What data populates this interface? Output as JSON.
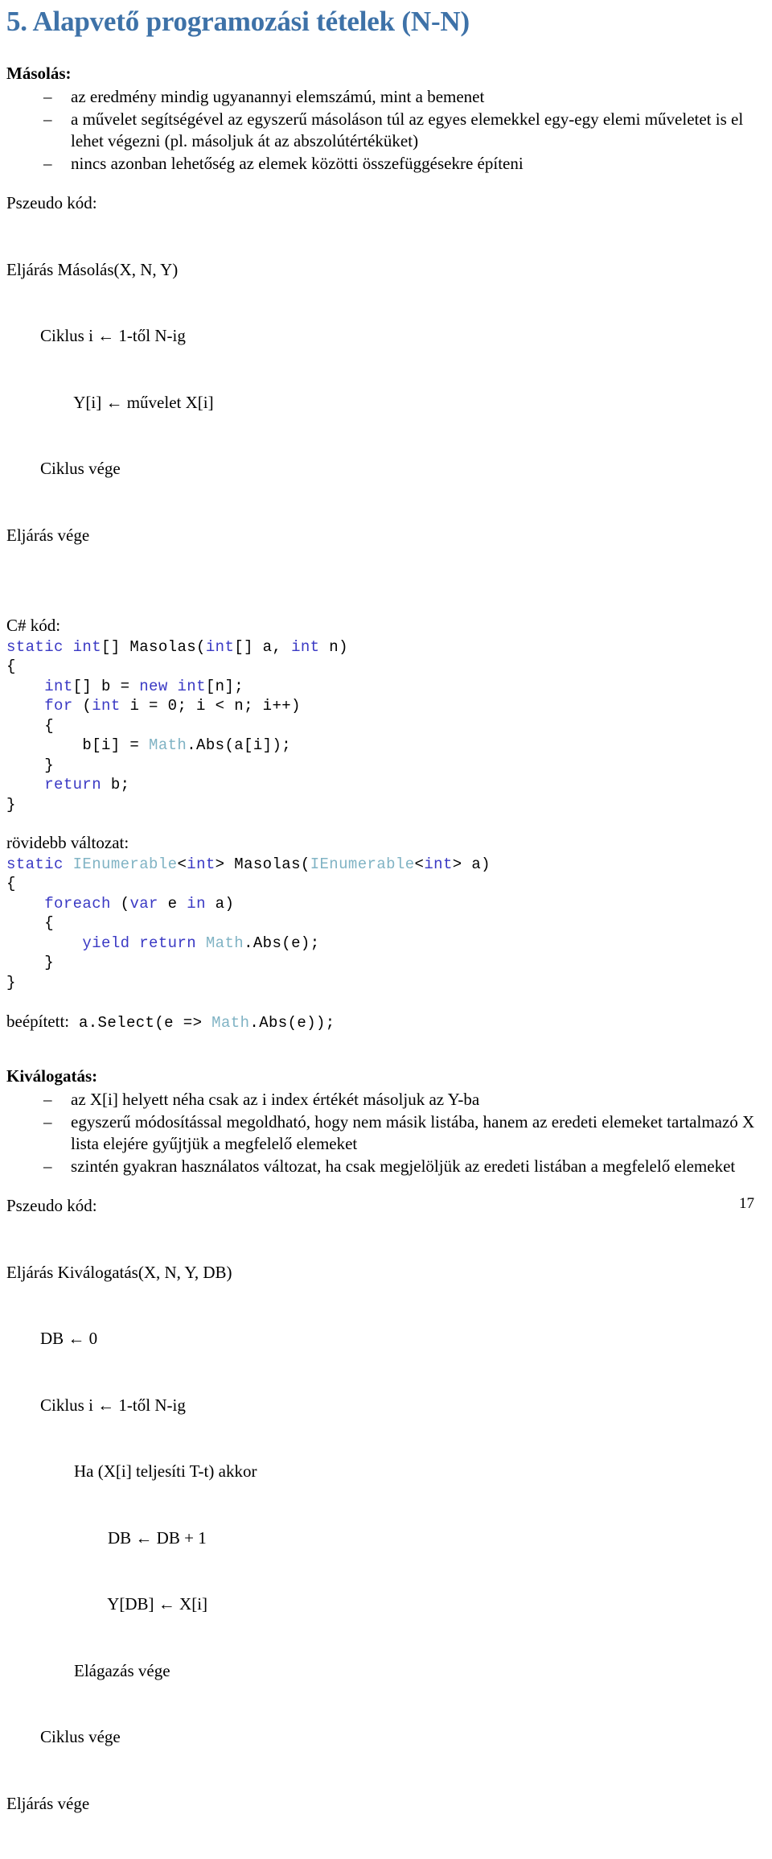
{
  "document": {
    "title": "5. Alapvető programozási tételek (N-N)",
    "title_color": "#3E72A8",
    "page_number": "17"
  },
  "sections": [
    {
      "heading": "Másolás:",
      "bullets": [
        "az eredmény mindig ugyanannyi elemszámú, mint a bemenet",
        "a művelet segítségével az egyszerű másoláson túl az egyes elemekkel egy-egy elemi műveletet is el lehet végezni (pl. másoljuk át az abszolútértéküket)",
        "nincs azonban lehetőség az elemek közötti összefüggésekre építeni"
      ],
      "pseudo_label": "Pszeudo kód:",
      "pseudo_lines": [
        "Eljárás Másolás(X, N, Y)",
        "        Ciklus i ← 1-től N-ig",
        "                Y[i] ← művelet X[i]",
        "        Ciklus vége",
        "Eljárás vége"
      ]
    }
  ],
  "csharp": {
    "label": "C# kód:",
    "lines": [
      [
        {
          "t": "static",
          "c": "kw"
        },
        {
          "t": " ",
          "c": "pun"
        },
        {
          "t": "int",
          "c": "kw"
        },
        {
          "t": "[] Masolas(",
          "c": "pun"
        },
        {
          "t": "int",
          "c": "kw"
        },
        {
          "t": "[] a, ",
          "c": "pun"
        },
        {
          "t": "int",
          "c": "kw"
        },
        {
          "t": " n)",
          "c": "pun"
        }
      ],
      [
        {
          "t": "{",
          "c": "pun"
        }
      ],
      [
        {
          "t": "    ",
          "c": "pun"
        },
        {
          "t": "int",
          "c": "kw"
        },
        {
          "t": "[] b = ",
          "c": "pun"
        },
        {
          "t": "new",
          "c": "kw"
        },
        {
          "t": " ",
          "c": "pun"
        },
        {
          "t": "int",
          "c": "kw"
        },
        {
          "t": "[n];",
          "c": "pun"
        }
      ],
      [
        {
          "t": "    ",
          "c": "pun"
        },
        {
          "t": "for",
          "c": "kw"
        },
        {
          "t": " (",
          "c": "pun"
        },
        {
          "t": "int",
          "c": "kw"
        },
        {
          "t": " i = 0; i < n; i++)",
          "c": "pun"
        }
      ],
      [
        {
          "t": "    {",
          "c": "pun"
        }
      ],
      [
        {
          "t": "        b[i] = ",
          "c": "pun"
        },
        {
          "t": "Math",
          "c": "typ"
        },
        {
          "t": ".Abs(a[i]);",
          "c": "pun"
        }
      ],
      [
        {
          "t": "    }",
          "c": "pun"
        }
      ],
      [
        {
          "t": "    ",
          "c": "pun"
        },
        {
          "t": "return",
          "c": "kw"
        },
        {
          "t": " b;",
          "c": "pun"
        }
      ],
      [
        {
          "t": "}",
          "c": "pun"
        }
      ]
    ]
  },
  "shorter": {
    "label": "rövidebb változat:",
    "lines": [
      [
        {
          "t": "static",
          "c": "kw"
        },
        {
          "t": " ",
          "c": "pun"
        },
        {
          "t": "IEnumerable",
          "c": "typ"
        },
        {
          "t": "<",
          "c": "pun"
        },
        {
          "t": "int",
          "c": "kw"
        },
        {
          "t": "> Masolas(",
          "c": "pun"
        },
        {
          "t": "IEnumerable",
          "c": "typ"
        },
        {
          "t": "<",
          "c": "pun"
        },
        {
          "t": "int",
          "c": "kw"
        },
        {
          "t": "> a)",
          "c": "pun"
        }
      ],
      [
        {
          "t": "{",
          "c": "pun"
        }
      ],
      [
        {
          "t": "    ",
          "c": "pun"
        },
        {
          "t": "foreach",
          "c": "kw"
        },
        {
          "t": " (",
          "c": "pun"
        },
        {
          "t": "var",
          "c": "kw"
        },
        {
          "t": " e ",
          "c": "pun"
        },
        {
          "t": "in",
          "c": "kw"
        },
        {
          "t": " a)",
          "c": "pun"
        }
      ],
      [
        {
          "t": "    {",
          "c": "pun"
        }
      ],
      [
        {
          "t": "        ",
          "c": "pun"
        },
        {
          "t": "yield return",
          "c": "kw"
        },
        {
          "t": " ",
          "c": "pun"
        },
        {
          "t": "Math",
          "c": "typ"
        },
        {
          "t": ".Abs(e);",
          "c": "pun"
        }
      ],
      [
        {
          "t": "    }",
          "c": "pun"
        }
      ],
      [
        {
          "t": "}",
          "c": "pun"
        }
      ]
    ]
  },
  "builtin": {
    "label": "beépített:",
    "code_parts": [
      {
        "t": " a.Select(e => ",
        "c": "pun"
      },
      {
        "t": "Math",
        "c": "typ"
      },
      {
        "t": ".Abs(e));",
        "c": "pun"
      }
    ]
  },
  "selection": {
    "heading": "Kiválogatás:",
    "bullets": [
      "az X[i] helyett néha csak az i index értékét másoljuk az Y-ba",
      "egyszerű módosítással megoldható, hogy nem másik listába, hanem az eredeti elemeket tartalmazó X lista elejére gyűjtjük a megfelelő elemeket",
      "szintén gyakran használatos változat, ha csak megjelöljük az eredeti listában a megfelelő elemeket"
    ],
    "pseudo_label": "Pszeudo kód:",
    "pseudo_lines": [
      "Eljárás Kiválogatás(X, N, Y, DB)",
      "        DB ← 0",
      "        Ciklus i ← 1-től N-ig",
      "                Ha (X[i] teljesíti T-t) akkor",
      "                        DB ← DB + 1",
      "                        Y[DB] ← X[i]",
      "                Elágazás vége",
      "        Ciklus vége",
      "Eljárás vége"
    ]
  }
}
